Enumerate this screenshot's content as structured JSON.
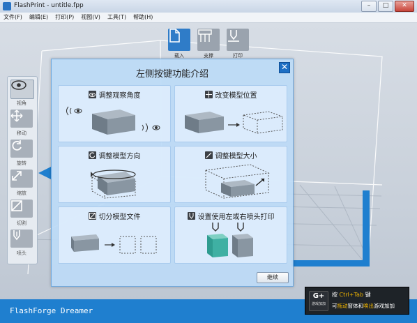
{
  "window": {
    "title": "FlashPrint - untitle.fpp",
    "min_label": "–",
    "max_label": "□",
    "close_label": "✕"
  },
  "menu": [
    "文件(F)",
    "编辑(E)",
    "打印(P)",
    "视图(V)",
    "工具(T)",
    "帮助(H)"
  ],
  "toolbar": {
    "load_label": "载入",
    "support_label": "支撑",
    "print_label": "打印"
  },
  "left_tools": [
    {
      "label": "视角",
      "icon": "eye-icon"
    },
    {
      "label": "移动",
      "icon": "move-icon"
    },
    {
      "label": "旋转",
      "icon": "rotate-icon"
    },
    {
      "label": "缩放",
      "icon": "scale-icon"
    },
    {
      "label": "切割",
      "icon": "cut-icon"
    },
    {
      "label": "喷头",
      "icon": "nozzle-icon"
    }
  ],
  "status": {
    "text": "FlashForge Dreamer"
  },
  "dialog": {
    "title": "左侧按键功能介绍",
    "close_label": "✕",
    "ok_label": "继续",
    "cards": [
      {
        "title": "调整观察角度",
        "icon": "eye-icon"
      },
      {
        "title": "改变模型位置",
        "icon": "move-icon"
      },
      {
        "title": "调整模型方向",
        "icon": "rotate-icon"
      },
      {
        "title": "调整模型大小",
        "icon": "scale-icon"
      },
      {
        "title": "切分模型文件",
        "icon": "cut-icon"
      },
      {
        "title": "设置使用左或右喷头打印",
        "icon": "nozzle-icon"
      }
    ]
  },
  "toast": {
    "logo_main": "G+",
    "logo_sub": "游戏加加",
    "line1_prefix": "按",
    "line1_key": "Ctrl+Tab",
    "line1_suffix": "键",
    "line2_a": "可",
    "line2_b": "拖动",
    "line2_c": "窗体和",
    "line2_d": "唤出",
    "line2_e": "游戏加加"
  },
  "colors": {
    "accent": "#1f7fcf",
    "active_tool": "#2f7cc8",
    "highlight": "#f0b400",
    "model_teal": "#3fb0a3"
  }
}
